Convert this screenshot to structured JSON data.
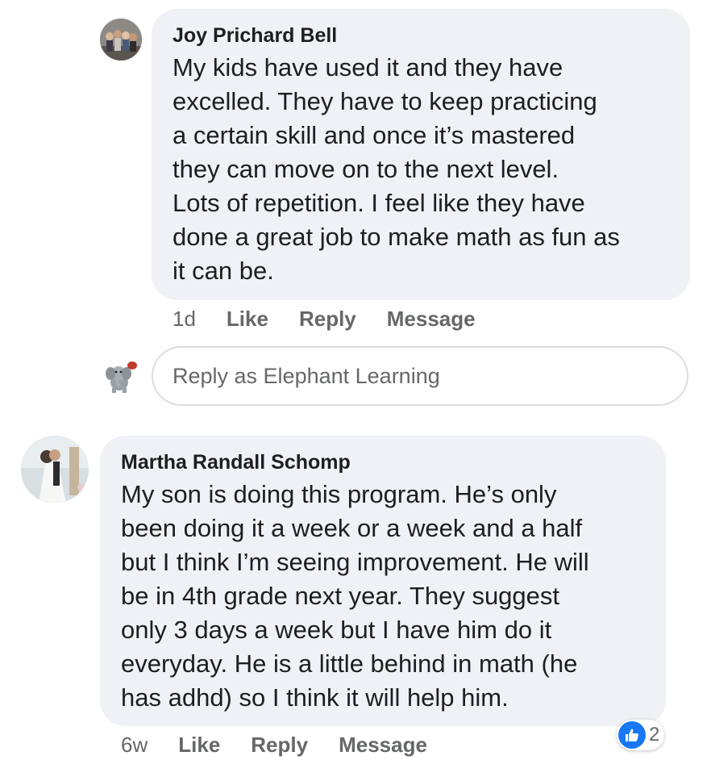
{
  "comments": [
    {
      "author": "Joy Prichard Bell",
      "text": "My kids have used it and they have\nexcelled.  They have to keep practicing\na certain skill and once it’s mastered\nthey can move on to the next level.\nLots of repetition.  I feel like they have\ndone a great job to make math as fun as\nit can be.",
      "time": "1d",
      "actions": [
        "Like",
        "Reply",
        "Message"
      ]
    },
    {
      "author": "Martha Randall Schomp",
      "text": "My son is doing this program. He’s only\nbeen doing it a week or a week and a half\nbut I think I’m seeing improvement. He will\nbe in 4th grade next year. They suggest\nonly 3 days a week but I have him do it\neveryday. He is a little behind in math (he\nhas adhd) so I think it will help him.",
      "time": "6w",
      "actions": [
        "Like",
        "Reply",
        "Message"
      ],
      "reactions": {
        "icon": "thumbs-up-icon",
        "count": "2"
      }
    }
  ],
  "reply_input": {
    "placeholder": "Reply as Elephant Learning"
  },
  "colors": {
    "bubble": "#f0f1f4",
    "secondary_text": "#65676b",
    "like_blue": "#1877f2"
  }
}
